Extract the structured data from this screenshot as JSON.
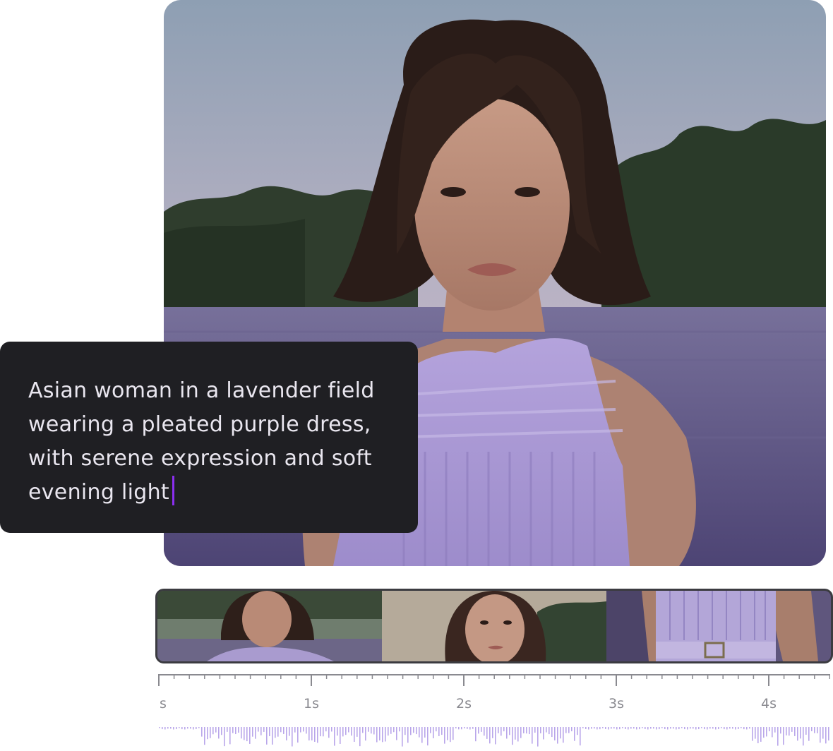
{
  "prompt": {
    "text": "Asian woman in a lavender field\nwearing a pleated purple dress,\nwith serene expression and soft\nevening light"
  },
  "preview": {
    "subject": "woman-in-lavender-field-image"
  },
  "filmstrip": {
    "frames": [
      "frame-1",
      "frame-2",
      "frame-3"
    ]
  },
  "timeline": {
    "labels": [
      "s",
      "1s",
      "2s",
      "3s",
      "4s"
    ],
    "seconds": [
      0,
      1,
      2,
      3,
      4
    ]
  },
  "colors": {
    "accent": "#8b2ef0",
    "card_bg": "#1f1f23",
    "waveform": "#b9a6ea",
    "ruler": "#8a8a90"
  }
}
